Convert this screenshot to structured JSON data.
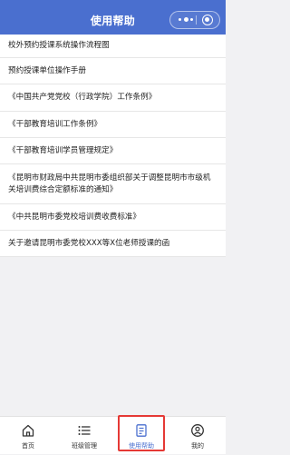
{
  "header": {
    "title": "使用帮助"
  },
  "items": [
    {
      "label": "校外预约授课系统操作流程图"
    },
    {
      "label": "预约授课单位操作手册"
    },
    {
      "label": "《中国共产党党校（行政学院）工作条例》"
    },
    {
      "label": "《干部教育培训工作条例》"
    },
    {
      "label": "《干部教育培训学员管理规定》"
    },
    {
      "label": "《昆明市财政局中共昆明市委组织部关于调整昆明市市级机关培训费综合定额标准的通知》"
    },
    {
      "label": "《中共昆明市委党校培训费收费标准》"
    },
    {
      "label": "关于邀请昆明市委党校XXX等X位老师授课的函"
    }
  ],
  "tabbar": {
    "tabs": [
      {
        "label": "首页",
        "icon": "home-icon"
      },
      {
        "label": "班级管理",
        "icon": "list-icon"
      },
      {
        "label": "使用帮助",
        "icon": "document-icon",
        "active": true
      },
      {
        "label": "我的",
        "icon": "user-icon"
      }
    ]
  },
  "colors": {
    "primary": "#4a6fcf",
    "highlight": "#e53935",
    "background": "#f1f1f3"
  }
}
